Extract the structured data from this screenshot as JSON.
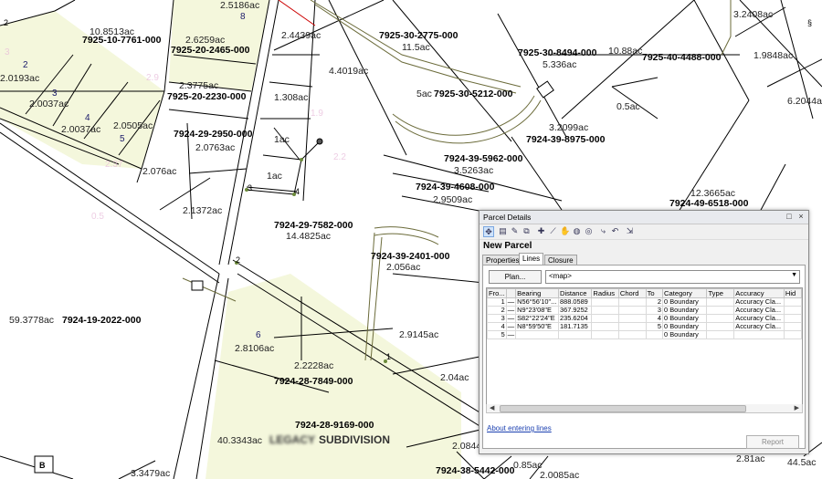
{
  "map": {
    "parcel_ids": [
      "7925-10-7761-000",
      "7925-20-2465-000",
      "7925-20-2230-000",
      "7924-29-2950-000",
      "7925-30-2775-000",
      "7925-30-8494-000",
      "7925-40-4488-000",
      "7925-30-5212-000",
      "7924-39-8975-000",
      "7924-39-5962-000",
      "7924-39-4608-000",
      "7924-49-6518-000",
      "7924-29-7582-000",
      "7924-39-2401-000",
      "7924-19-2022-000",
      "7924-28-7849-000",
      "7924-28-9169-000",
      "7924-38-5442-000"
    ],
    "acreages": [
      "2.5186ac",
      "10.8513ac",
      "2.6259ac",
      "2.4439ac",
      "11.5ac",
      "3.2408ac",
      "2.0193ac",
      "2.3775ac",
      "4.4019ac",
      "10.88ac",
      "5.336ac",
      "1.9848ac",
      "2.0037ac",
      "1.308ac",
      "5ac",
      "0.5ac",
      "6.2044a",
      "2.0505ac",
      "2.0763ac",
      "3.2099ac",
      "1ac",
      "2.076ac",
      "3.5263ac",
      "1ac",
      "2.9509ac",
      "2.1372ac",
      "12.3665ac",
      "14.4825ac",
      "2.056ac",
      "59.3778ac",
      "2.9145ac",
      "2.8106ac",
      "2.2228ac",
      "2.04ac",
      "40.3343ac",
      "2.0844",
      "3.3479ac",
      "0.85ac",
      "2.0085ac",
      "2.81ac",
      "44.5ac"
    ],
    "lot_numbers": [
      "8",
      "2",
      "3",
      "4",
      "5",
      "6",
      "2"
    ],
    "vertex_labels": [
      "3",
      "4",
      "2",
      "1",
      "2"
    ],
    "subdivision_label": "SUBDIVISION",
    "subdivision_blurred": "LEGACY",
    "corner_marker_label": "B",
    "marker_glyph": "§"
  },
  "dialog": {
    "title": "Parcel Details",
    "heading": "New Parcel",
    "tabs": [
      {
        "label": "Properties",
        "selected": false
      },
      {
        "label": "Lines",
        "selected": true
      },
      {
        "label": "Closure",
        "selected": false
      }
    ],
    "plan_button": "Plan...",
    "plan_value": "<map>",
    "columns": [
      "Fro...",
      "",
      "Bearing",
      "Distance",
      "Radius",
      "Chord",
      "To",
      "Category",
      "Type",
      "Accuracy",
      "Hid"
    ],
    "rows": [
      {
        "from": "1",
        "bearing": "N56°56'10\"...",
        "distance": "888.0589",
        "radius": "",
        "chord": "",
        "to": "2",
        "category": "0 Boundary",
        "type": "",
        "accuracy": "Accuracy Cla..."
      },
      {
        "from": "2",
        "bearing": "N9°23'08\"E",
        "distance": "367.9252",
        "radius": "",
        "chord": "",
        "to": "3",
        "category": "0 Boundary",
        "type": "",
        "accuracy": "Accuracy Cla..."
      },
      {
        "from": "3",
        "bearing": "S82°22'24\"E",
        "distance": "235.6204",
        "radius": "",
        "chord": "",
        "to": "4",
        "category": "0 Boundary",
        "type": "",
        "accuracy": "Accuracy Cla..."
      },
      {
        "from": "4",
        "bearing": "N8°59'50\"E",
        "distance": "181.7135",
        "radius": "",
        "chord": "",
        "to": "5",
        "category": "0 Boundary",
        "type": "",
        "accuracy": "Accuracy Cla..."
      },
      {
        "from": "5",
        "bearing": "",
        "distance": "",
        "radius": "",
        "chord": "",
        "to": "",
        "category": "0 Boundary",
        "type": "",
        "accuracy": ""
      }
    ],
    "about_link": "About entering lines",
    "report_button": "Report",
    "titlebar_buttons": [
      "□",
      "×"
    ]
  },
  "colors": {
    "parcel_line": "#000000",
    "highlight_fill": "#f4f7dc",
    "road_trace": "#6b6b3a",
    "ghost_label": "#e6b8d8",
    "link": "#1a3fb0"
  }
}
